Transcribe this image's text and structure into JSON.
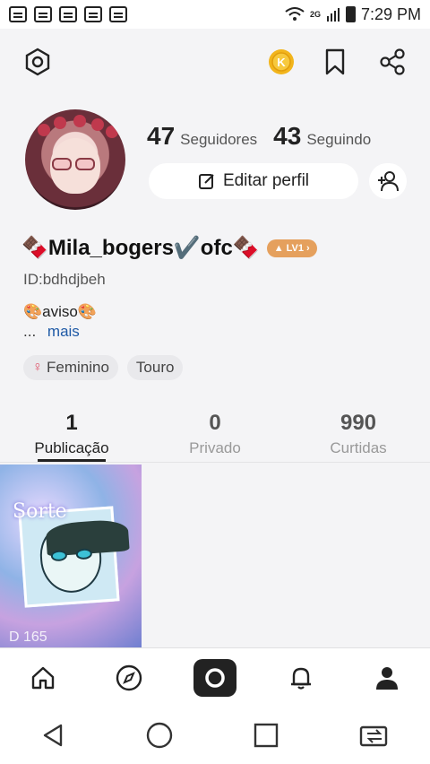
{
  "status_bar": {
    "time": "7:29 PM",
    "network": "2G",
    "notification_icons": [
      "mail-icon",
      "lg-icon",
      "message-icon",
      "qq-icon",
      "message-icon"
    ]
  },
  "header": {
    "icons": [
      "settings-hex-icon",
      "coin-icon",
      "bookmark-icon",
      "share-icon"
    ]
  },
  "profile": {
    "followers_count": "47",
    "followers_label": "Seguidores",
    "following_count": "43",
    "following_label": "Seguindo",
    "edit_label": "Editar perfil",
    "username": "🍫Mila_bogers✔️ofc🍫",
    "level_badge": "LV1",
    "id_text": "ID:bdhdjbeh",
    "bio": "🎨aviso🎨",
    "ellipsis": "...",
    "more_label": "mais",
    "tags": [
      {
        "label": "Feminino"
      },
      {
        "label": "Touro"
      }
    ]
  },
  "tabs": [
    {
      "count": "1",
      "label": "Publicação",
      "active": true
    },
    {
      "count": "0",
      "label": "Privado",
      "active": false
    },
    {
      "count": "990",
      "label": "Curtidas",
      "active": false
    }
  ],
  "posts": [
    {
      "title": "Sorte",
      "caption": "D 165"
    }
  ],
  "colors": {
    "accent_link": "#1f5aa6",
    "level_badge": "#e5a05d",
    "coin": "#f2b51c",
    "female": "#e0546a"
  },
  "bottom_nav": [
    "home-icon",
    "explore-compass-icon",
    "camera-icon",
    "bell-icon",
    "profile-icon"
  ],
  "system_nav": [
    "back-icon",
    "home-circle-icon",
    "recents-icon",
    "switch-app-icon"
  ]
}
